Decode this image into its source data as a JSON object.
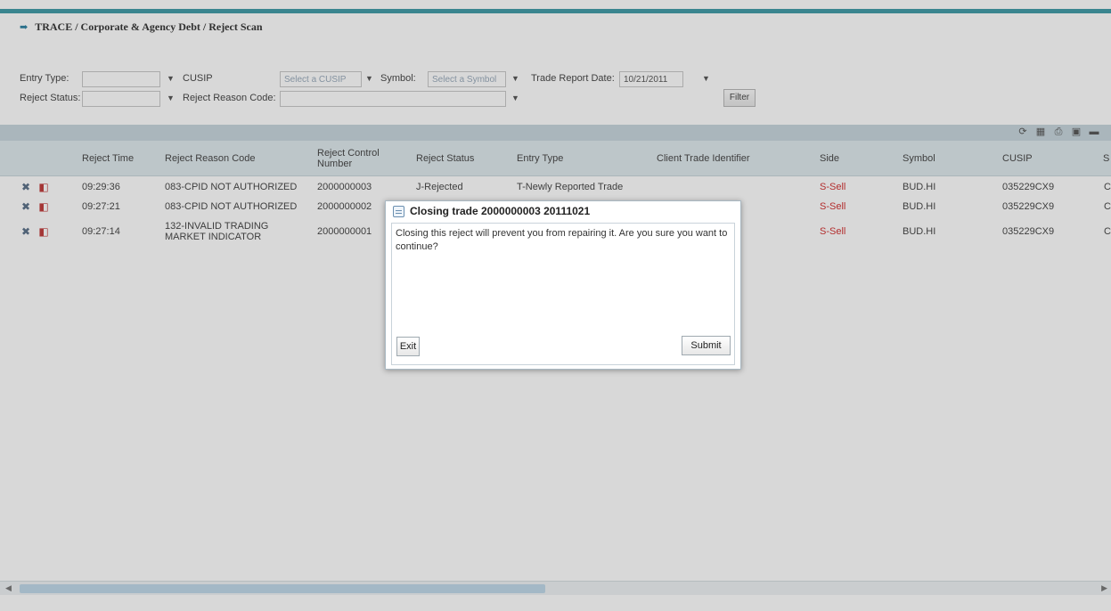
{
  "breadcrumb": {
    "text": "TRACE / Corporate & Agency Debt / Reject Scan"
  },
  "filters": {
    "entry_type_label": "Entry Type:",
    "cusip_label": "CUSIP",
    "cusip_placeholder": "Select a CUSIP",
    "symbol_label": "Symbol:",
    "symbol_placeholder": "Select a Symbol",
    "trade_report_date_label": "Trade Report Date:",
    "trade_report_date_value": "10/21/2011",
    "reject_status_label": "Reject Status:",
    "reject_reason_code_label": "Reject Reason Code:",
    "filter_button": "Filter"
  },
  "toolbar_icons": [
    "refresh-icon",
    "csv-export-icon",
    "print-icon",
    "save-icon",
    "minimize-icon"
  ],
  "table": {
    "columns": [
      "Reject Time",
      "Reject Reason Code",
      "Reject Control Number",
      "Reject Status",
      "Entry Type",
      "Client Trade Identifier",
      "Side",
      "Symbol",
      "CUSIP",
      "S"
    ],
    "rows": [
      {
        "time": "09:29:36",
        "reason": "083-CPID NOT AUTHORIZED",
        "control": "2000000003",
        "status": "J-Rejected",
        "entry_type": "T-Newly Reported Trade",
        "client_id": "",
        "side": "S-Sell",
        "symbol": "BUD.HI",
        "cusip": "035229CX9",
        "extra": "C"
      },
      {
        "time": "09:27:21",
        "reason": "083-CPID NOT AUTHORIZED",
        "control": "2000000002",
        "status": "",
        "entry_type": "",
        "client_id": "",
        "side": "S-Sell",
        "symbol": "BUD.HI",
        "cusip": "035229CX9",
        "extra": "C"
      },
      {
        "time": "09:27:14",
        "reason": "132-INVALID TRADING MARKET INDICATOR",
        "control": "2000000001",
        "status": "",
        "entry_type": "",
        "client_id": "",
        "side": "S-Sell",
        "symbol": "BUD.HI",
        "cusip": "035229CX9",
        "extra": "C"
      }
    ]
  },
  "dialog": {
    "title": "Closing trade 2000000003 20111021",
    "message": "Closing this reject will prevent you from repairing it. Are you sure you want to continue?",
    "exit_button": "Exit",
    "submit_button": "Submit"
  },
  "colors": {
    "accent": "#3f9aa6",
    "header_bg": "#dfe9ed",
    "sell_red": "#d23030"
  }
}
